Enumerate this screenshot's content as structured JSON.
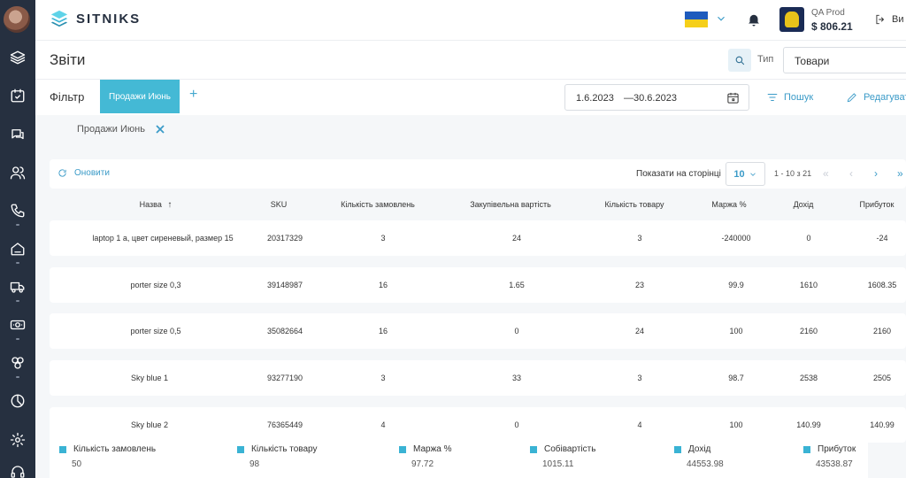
{
  "brand": {
    "name": "SITNIKS"
  },
  "account": {
    "name": "QA Prod",
    "balance": "$ 806.21",
    "logout_label": "Ви"
  },
  "page": {
    "title": "Звіти",
    "type_label": "Тип",
    "type_value": "Товари"
  },
  "filter": {
    "label": "Фільтр",
    "active_tab": "Продажи Июнь",
    "add_label": "+",
    "date_from": "1.6.2023",
    "date_sep": "—",
    "date_to": "30.6.2023",
    "search_label": "Пошук",
    "edit_label": "Редагувати",
    "chip_label": "Продажи Июнь"
  },
  "toolbar": {
    "refresh_label": "Оновити",
    "per_page_label": "Показати на сторінці",
    "per_page_value": "10",
    "range": "1 - 10 з 21",
    "first": "«",
    "prev": "‹",
    "next": "›",
    "last": "»"
  },
  "table": {
    "columns": [
      "Назва",
      "SKU",
      "Кількість замовлень",
      "Закупівельна вартість",
      "Кількість товару",
      "Маржа %",
      "Дохід",
      "Прибуток"
    ],
    "sort_indicator": "↑",
    "rows": [
      [
        "laptop 1 a, цвет сиреневый, размер 15",
        "20317329",
        "3",
        "24",
        "3",
        "-240000",
        "0",
        "-24"
      ],
      [
        "porter size 0,3",
        "39148987",
        "16",
        "1.65",
        "23",
        "99.9",
        "1610",
        "1608.35"
      ],
      [
        "porter size 0,5",
        "35082664",
        "16",
        "0",
        "24",
        "100",
        "2160",
        "2160"
      ],
      [
        "Sky blue 1",
        "93277190",
        "3",
        "33",
        "3",
        "98.7",
        "2538",
        "2505"
      ],
      [
        "Sky blue 2",
        "76365449",
        "4",
        "0",
        "4",
        "100",
        "140.99",
        "140.99"
      ]
    ]
  },
  "totals": [
    {
      "label": "Кількість замовлень",
      "value": "50"
    },
    {
      "label": "Кількість товару",
      "value": "98"
    },
    {
      "label": "Маржа %",
      "value": "97.72"
    },
    {
      "label": "Собівартість",
      "value": "1015.11"
    },
    {
      "label": "Дохід",
      "value": "44553.98"
    },
    {
      "label": "Прибуток",
      "value": "43538.87"
    }
  ],
  "colors": {
    "accent": "#44b9d5",
    "sidebar": "#263040",
    "link": "#3b9bc8"
  },
  "icons": {
    "sidebar": [
      "layers-icon",
      "calendar-check-icon",
      "chat-icon",
      "users-icon",
      "phone-icon",
      "home-icon",
      "truck-icon",
      "cash-icon",
      "shapes-icon",
      "pie-chart-icon",
      "gear-icon",
      "headset-icon"
    ]
  }
}
